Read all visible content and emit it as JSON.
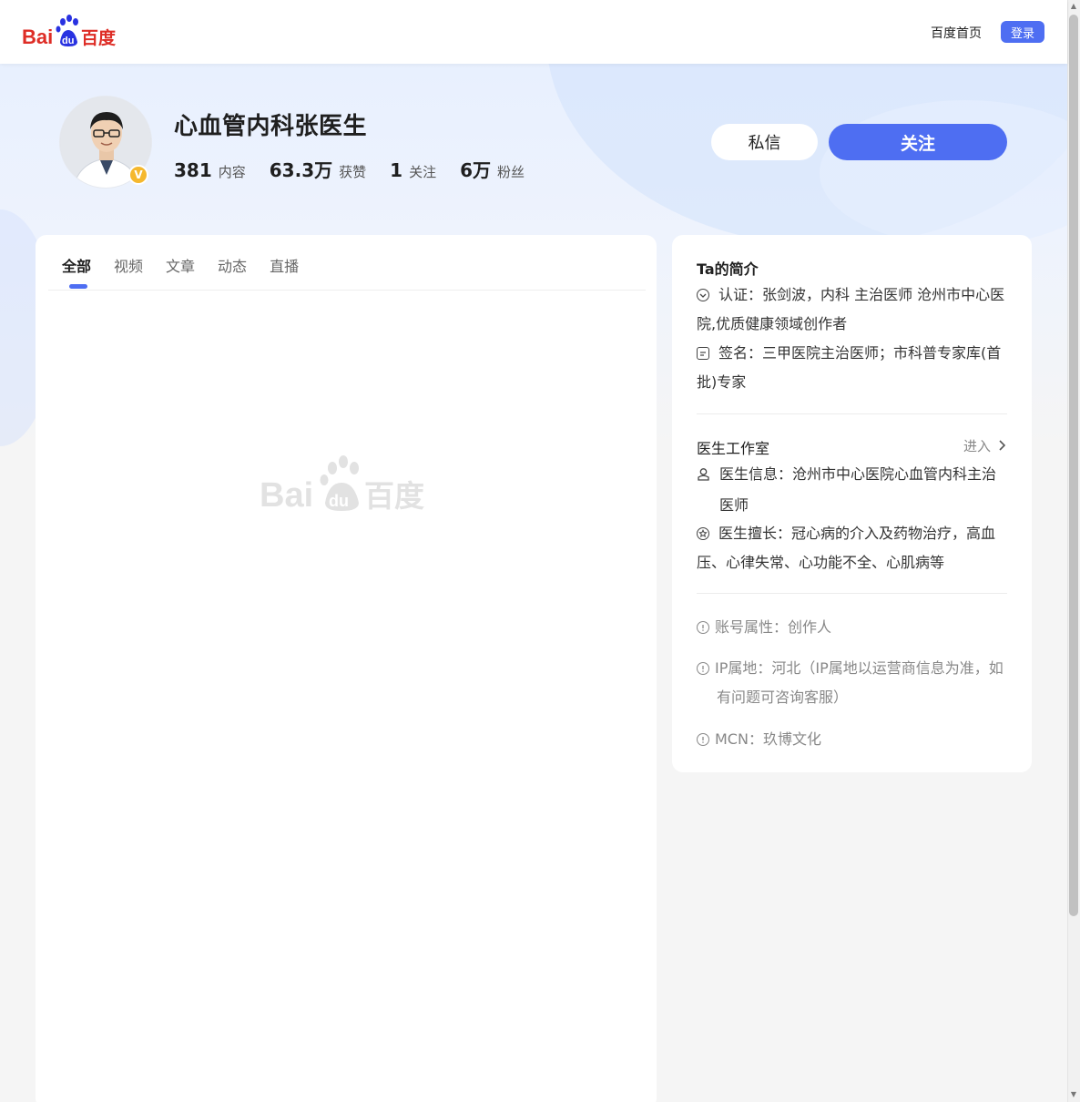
{
  "nav": {
    "logo_text": "Bai百度",
    "home_link": "百度首页",
    "login_label": "登录"
  },
  "profile": {
    "name": "心血管内科张医生",
    "badge": "V",
    "stats": [
      {
        "value": "381",
        "label": "内容"
      },
      {
        "value": "63.3万",
        "label": "获赞"
      },
      {
        "value": "1",
        "label": "关注"
      },
      {
        "value": "6万",
        "label": "粉丝"
      }
    ],
    "message_label": "私信",
    "follow_label": "关注"
  },
  "tabs": [
    {
      "label": "全部",
      "active": true
    },
    {
      "label": "视频",
      "active": false
    },
    {
      "label": "文章",
      "active": false
    },
    {
      "label": "动态",
      "active": false
    },
    {
      "label": "直播",
      "active": false
    }
  ],
  "intro": {
    "title": "Ta的简介",
    "certification": "认证：张剑波，内科 主治医师 沧州市中心医院,优质健康领域创作者",
    "signature": "签名：三甲医院主治医师；市科普专家库(首批)专家"
  },
  "studio": {
    "title": "医生工作室",
    "enter_label": "进入",
    "info": "医生信息：沧州市中心医院心血管内科主治医师",
    "specialty": "医生擅长：冠心病的介入及药物治疗，高血压、心律失常、心功能不全、心肌病等"
  },
  "account": {
    "type": "账号属性：创作人",
    "ip": "IP属地：河北（IP属地以运营商信息为准，如有问题可咨询客服）",
    "mcn": "MCN：玖博文化"
  },
  "colors": {
    "accent": "#4e6ef2",
    "baidu_red": "#de2d26",
    "baidu_blue": "#2932e1"
  },
  "icons": {
    "verified": "verified-check-icon",
    "signature": "note-icon",
    "doctor": "doctor-icon",
    "specialty": "star-circle-icon",
    "info": "info-circle-icon",
    "chevron": "chevron-right-icon"
  }
}
